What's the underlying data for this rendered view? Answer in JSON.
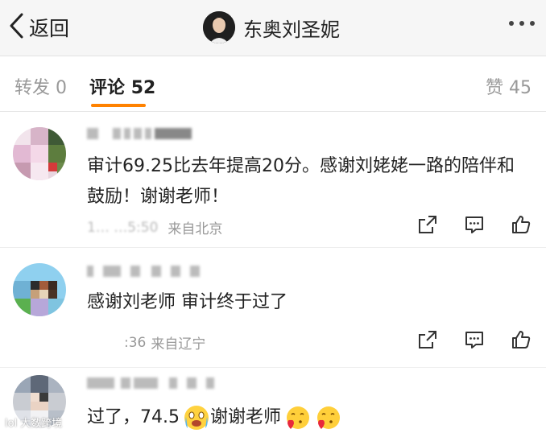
{
  "header": {
    "back_label": "返回",
    "title": "东奥刘圣妮"
  },
  "tabs": {
    "repost_label": "转发",
    "repost_count": "0",
    "comment_label": "评论",
    "comment_count": "52",
    "like_label": "赞",
    "like_count": "45",
    "accent_color": "#ff8200"
  },
  "comments": [
    {
      "text": "审计69.25比去年提高20分。感谢刘姥姥一路的陪伴和鼓励！谢谢老师！",
      "time": "1…  …5:50",
      "location": "来自北京"
    },
    {
      "text": "感谢刘老师 审计终于过了",
      "time": ":36",
      "location": "来自辽宁"
    },
    {
      "text_prefix": "过了，74.5",
      "text_suffix": "谢谢老师"
    }
  ],
  "watermark": "lol 大数跨境",
  "icons": [
    "back-arrow-icon",
    "more-dots-icon",
    "share-icon",
    "comment-icon",
    "like-icon"
  ]
}
